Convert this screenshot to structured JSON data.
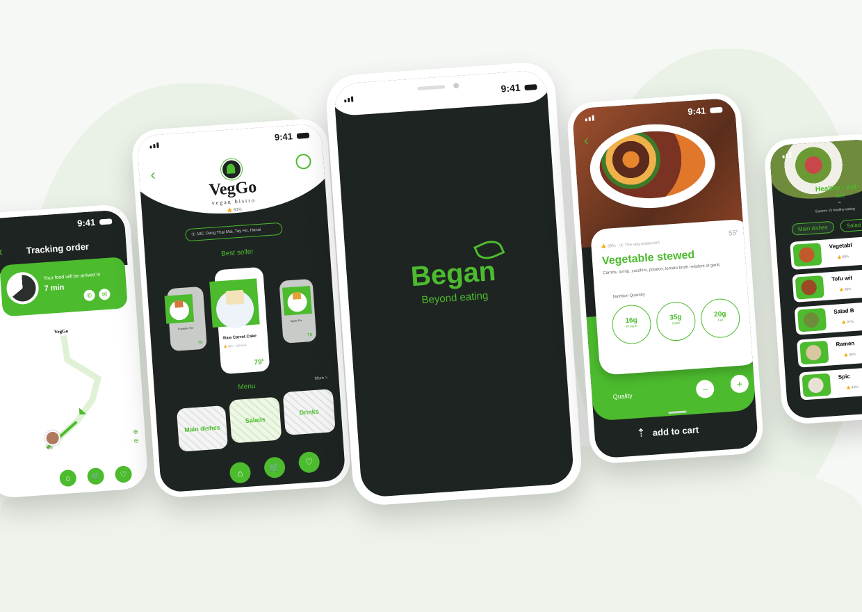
{
  "status_time": "9:41",
  "phone1": {
    "title": "Tracking order",
    "notice": "Your food will be arrived in",
    "eta": "7 min",
    "map_logo": "VegGo",
    "courier_label": "Olly"
  },
  "phone2": {
    "brand": "VegGo",
    "tagline": "vegan bistro",
    "rating": "80%",
    "address": "18C Dang Thai Mai, Tay Ho, Hanoi",
    "best_seller_label": "Best seller",
    "items": [
      {
        "name": "Pumpkin Pie",
        "price": "75"
      },
      {
        "name": "Raw Carrot Cake",
        "meta": "96% · 250 kcal",
        "price": "79"
      },
      {
        "name": "Apple Pie",
        "price": "79"
      }
    ],
    "price_suffix": "k",
    "menu_label": "Menu",
    "more_label": "More >",
    "menu": [
      "Main dishes",
      "Salads",
      "Drinks"
    ]
  },
  "phone3": {
    "brand": "Began",
    "slogan": "Beyond eating"
  },
  "phone4": {
    "rating": "98%",
    "restaurant": "The veg restaurant",
    "price": "55",
    "price_suffix": "k",
    "title": "Vegetable stewed",
    "description": "Carrots, turnip, zucchini, potatoe, tomato broth redolent of garlic",
    "nutrition_label": "Nutrition Quantity",
    "nutrition": [
      {
        "value": "16g",
        "name": "Protein"
      },
      {
        "value": "35g",
        "name": "Carb"
      },
      {
        "value": "20g",
        "name": "Fat"
      }
    ],
    "quantity_label": "Quality",
    "cart_label": "add to cart"
  },
  "phone5": {
    "heading": "Healthy - eat",
    "subheading": "diet",
    "explore": "Explore 15 healthy-eating",
    "tabs": [
      "Main dishes",
      "Salad"
    ],
    "items": [
      "Vegetabl",
      "Tofu wit",
      "Salad B",
      "Ramen",
      "Spic"
    ],
    "ratings": [
      "98%",
      "96%",
      "97%",
      "98%",
      "94%"
    ]
  },
  "colors": {
    "accent": "#4cbb2e",
    "dark": "#1e2422"
  }
}
